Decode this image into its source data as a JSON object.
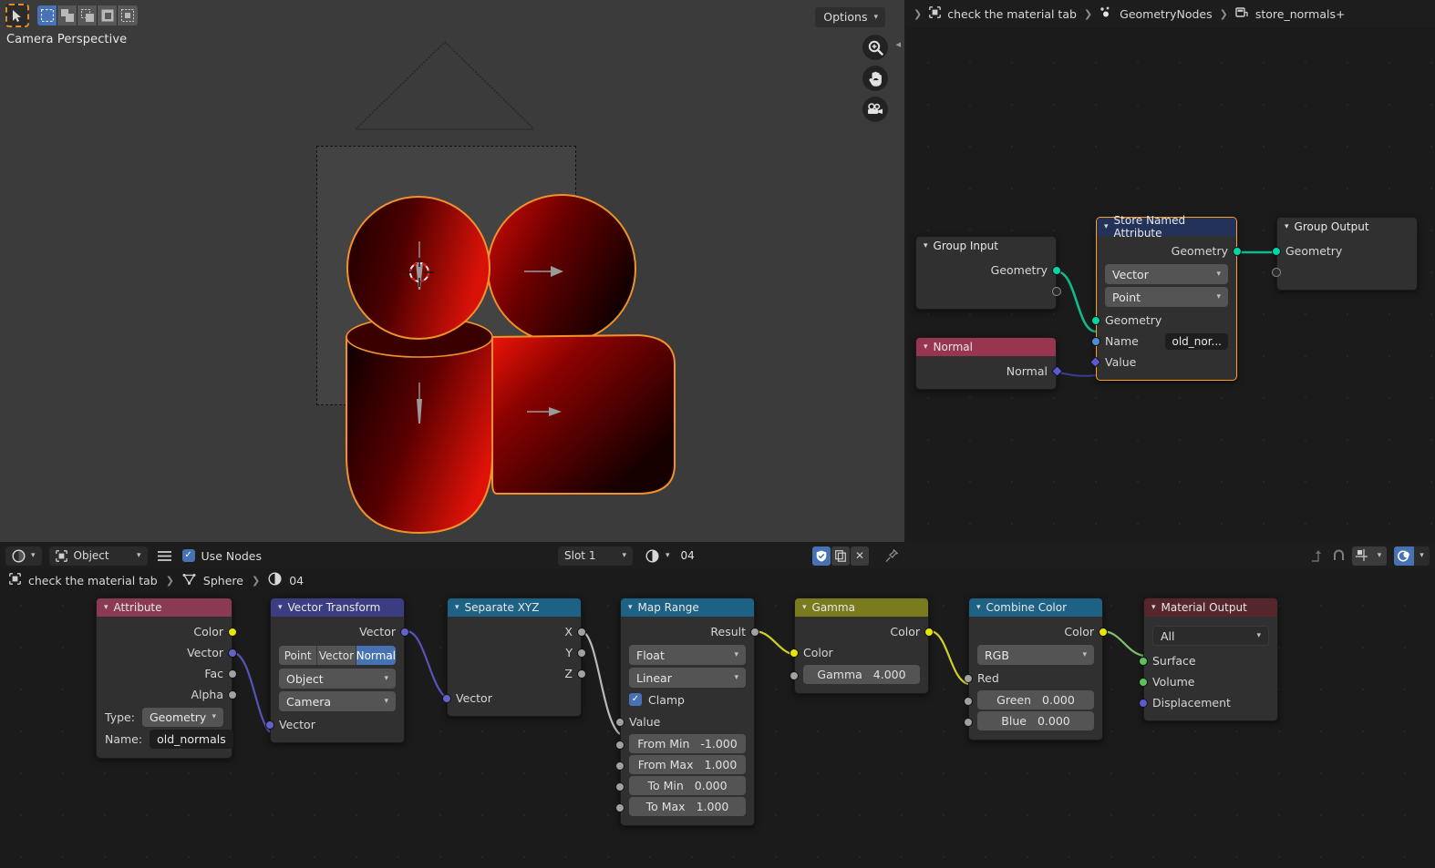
{
  "viewport": {
    "label": "Camera Perspective",
    "options_label": "Options",
    "tools": {
      "cursor_tool": "select-box-tool",
      "modes": [
        "select-new",
        "select-extend",
        "select-subtract",
        "select-invert",
        "select-intersect"
      ]
    },
    "gizmos": [
      "zoom-gizmo",
      "pan-gizmo",
      "camera-gizmo"
    ]
  },
  "geo_editor": {
    "breadcrumb": [
      {
        "icon": "object-icon",
        "label": "check the material tab"
      },
      {
        "icon": "geometry-nodes-icon",
        "label": "GeometryNodes"
      },
      {
        "icon": "node-group-icon",
        "label": "store_normals+"
      }
    ],
    "nodes": {
      "group_input": {
        "title": "Group Input",
        "outputs": [
          {
            "label": "Geometry",
            "color": "geo"
          },
          {
            "label": "",
            "color": "hollow"
          }
        ]
      },
      "normal": {
        "title": "Normal",
        "outputs": [
          {
            "label": "Normal",
            "color": "violet"
          }
        ]
      },
      "store_named_attribute": {
        "title": "Store Named Attribute",
        "output": {
          "label": "Geometry",
          "color": "geo"
        },
        "data_type": "Vector",
        "domain": "Point",
        "inputs": [
          {
            "label": "Geometry",
            "color": "geo"
          },
          {
            "label": "Name",
            "color": "blue",
            "value": "old_nor..."
          },
          {
            "label": "Value",
            "color": "violet"
          }
        ]
      },
      "group_output": {
        "title": "Group Output",
        "inputs": [
          {
            "label": "Geometry",
            "color": "geo"
          },
          {
            "label": "",
            "color": "hollow"
          }
        ]
      }
    }
  },
  "shader_editor": {
    "header": {
      "editor_type": "shader-editor-icon",
      "shader_type": "Object",
      "menu_icon": "hamburger-icon",
      "use_nodes_label": "Use Nodes",
      "use_nodes_checked": true,
      "slot": "Slot 1",
      "material_icon": "material-icon",
      "material_name": "04",
      "shield_icon": "fake-user-icon",
      "copy_icon": "new-material-icon",
      "x_icon": "unlink-icon",
      "pin_icon": "pin-icon",
      "right_icons": [
        "go-to-parent-icon",
        "snap-magnet-icon",
        "snap-grid-icon",
        "overlays-icon"
      ]
    },
    "breadcrumb": [
      {
        "icon": "object-icon",
        "label": "check the material tab"
      },
      {
        "icon": "mesh-data-icon",
        "label": "Sphere"
      },
      {
        "icon": "material-icon",
        "label": "04"
      }
    ],
    "nodes": {
      "attribute": {
        "title": "Attribute",
        "outputs": [
          {
            "label": "Color",
            "color": "yellow"
          },
          {
            "label": "Vector",
            "color": "purple"
          },
          {
            "label": "Fac",
            "color": "grey"
          },
          {
            "label": "Alpha",
            "color": "grey"
          }
        ],
        "type_label": "Type:",
        "type_value": "Geometry",
        "name_label": "Name:",
        "name_value": "old_normals"
      },
      "vector_transform": {
        "title": "Vector Transform",
        "output": {
          "label": "Vector",
          "color": "purple"
        },
        "vector_type_options": [
          "Point",
          "Vector",
          "Normal"
        ],
        "vector_type_active": "Normal",
        "convert_from": "Object",
        "convert_to": "Camera",
        "input": {
          "label": "Vector",
          "color": "purple"
        }
      },
      "separate_xyz": {
        "title": "Separate XYZ",
        "outputs": [
          {
            "label": "X",
            "color": "grey"
          },
          {
            "label": "Y",
            "color": "grey"
          },
          {
            "label": "Z",
            "color": "grey"
          }
        ],
        "input": {
          "label": "Vector",
          "color": "purple"
        }
      },
      "map_range": {
        "title": "Map Range",
        "output": {
          "label": "Result",
          "color": "grey"
        },
        "data_type": "Float",
        "interpolation": "Linear",
        "clamp_label": "Clamp",
        "clamp_checked": true,
        "value_input": "Value",
        "fields": [
          {
            "label": "From Min",
            "value": "-1.000"
          },
          {
            "label": "From Max",
            "value": "1.000"
          },
          {
            "label": "To Min",
            "value": "0.000"
          },
          {
            "label": "To Max",
            "value": "1.000"
          }
        ]
      },
      "gamma": {
        "title": "Gamma",
        "output": {
          "label": "Color",
          "color": "yellow"
        },
        "color_input": "Color",
        "gamma_label": "Gamma",
        "gamma_value": "4.000"
      },
      "combine_color": {
        "title": "Combine Color",
        "output": {
          "label": "Color",
          "color": "yellow"
        },
        "mode": "RGB",
        "red_label": "Red",
        "fields": [
          {
            "label": "Green",
            "value": "0.000"
          },
          {
            "label": "Blue",
            "value": "0.000"
          }
        ]
      },
      "material_output": {
        "title": "Material Output",
        "target": "All",
        "inputs": [
          {
            "label": "Surface",
            "color": "green"
          },
          {
            "label": "Volume",
            "color": "green"
          },
          {
            "label": "Displacement",
            "color": "violet"
          }
        ]
      }
    }
  },
  "colors": {
    "accent_blue": "#4772b3",
    "geometry_socket": "#00d6a3",
    "selected_outline": "#ffa028",
    "node_header_attribute": "#8a3a52",
    "node_header_vector": "#3c3c83",
    "node_header_converter": "#1d6184",
    "node_header_color": "#7a7a1e",
    "node_header_output": "#55262c"
  }
}
